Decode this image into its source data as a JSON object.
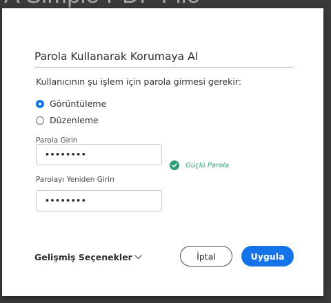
{
  "background": {
    "document_title_fragment": "A Simple PDF File"
  },
  "dialog": {
    "title": "Parola Kullanarak Korumaya Al",
    "prompt": "Kullanıcının şu işlem için parola girmesi gerekir:",
    "options": [
      {
        "label": "Görüntüleme",
        "checked": true
      },
      {
        "label": "Düzenleme",
        "checked": false
      }
    ],
    "password": {
      "label": "Parola Girin",
      "value": "••••••••"
    },
    "strength": {
      "text": "Güçlü Parola",
      "icon": "check-circle-icon"
    },
    "confirm": {
      "label": "Parolayı Yeniden Girin",
      "value": "••••••••"
    },
    "advanced": {
      "label": "Gelişmiş Seçenekler",
      "icon": "chevron-down-icon"
    },
    "buttons": {
      "cancel": "İptal",
      "apply": "Uygula"
    }
  },
  "colors": {
    "accent": "#1473e6",
    "success": "#2d9d78",
    "backdrop": "#3a3a3a",
    "dialog_bg": "#ffffff"
  }
}
